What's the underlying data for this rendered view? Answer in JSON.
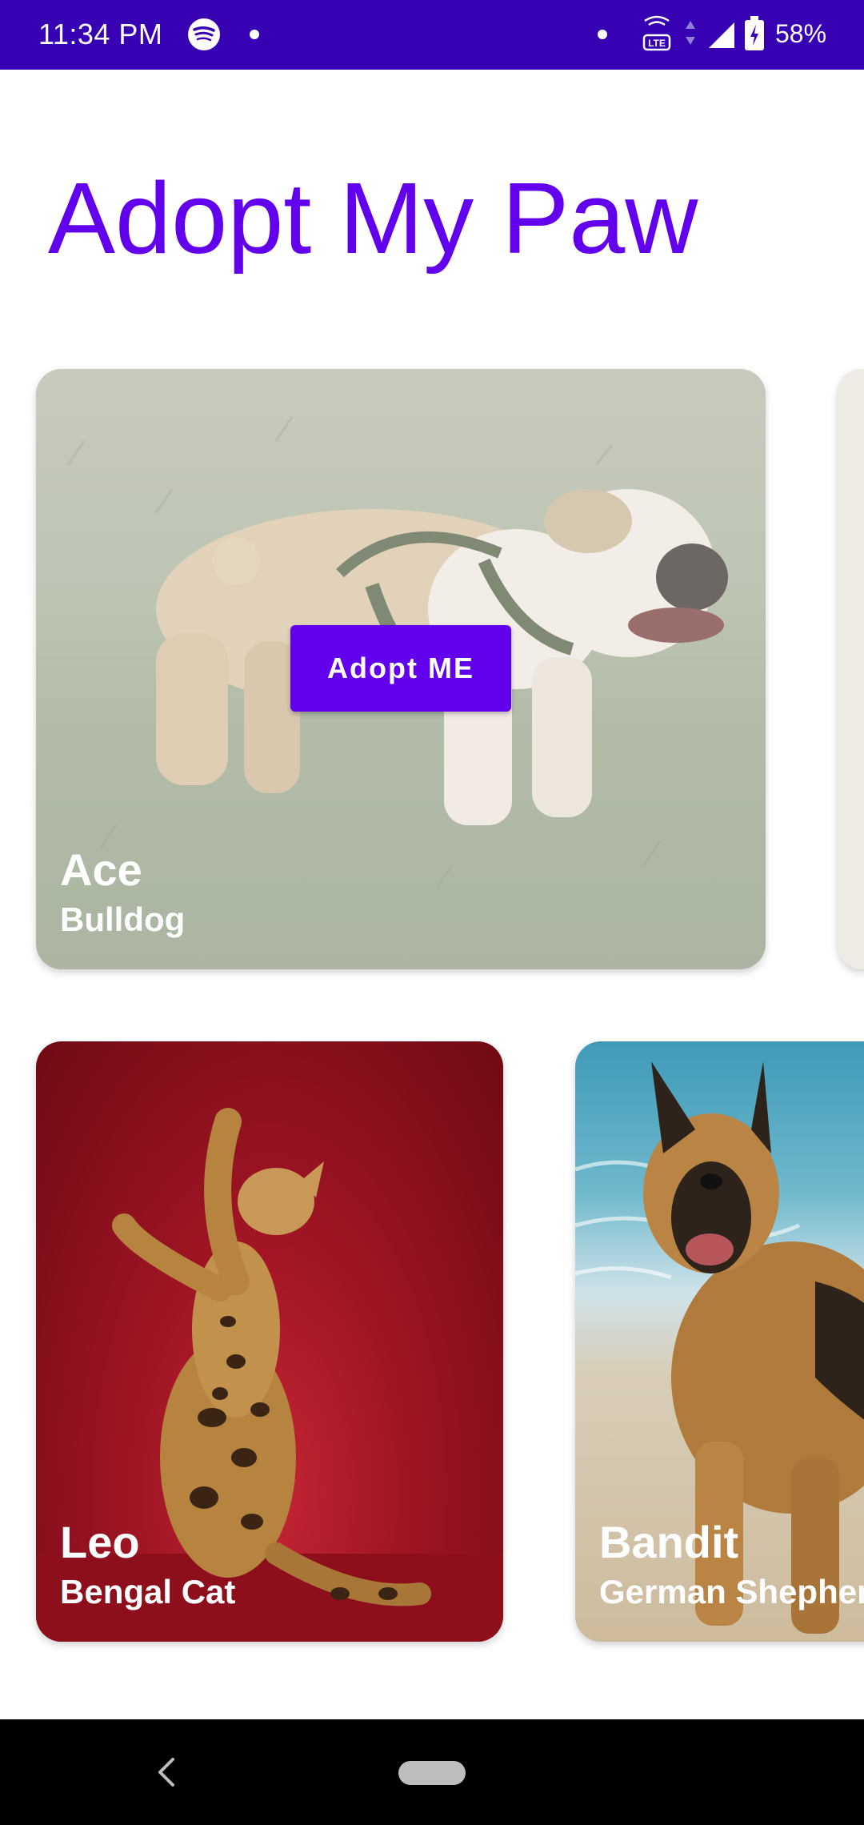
{
  "status_bar": {
    "time": "11:34 PM",
    "battery": "58%",
    "icons": [
      "spotify-icon",
      "notification-dot",
      "volte-icon",
      "data-arrows-icon",
      "signal-icon",
      "battery-icon"
    ]
  },
  "app": {
    "title": "Adopt My Paw"
  },
  "pets": [
    {
      "name": "Ace",
      "breed": "Bulldog",
      "action_label": "Adopt ME",
      "selected": true
    },
    {
      "name": "Leo",
      "breed": "Bengal Cat"
    },
    {
      "name": "Bandit",
      "breed": "German Shepherd"
    }
  ],
  "colors": {
    "status_bar": "#3700b3",
    "accent": "#6200ee",
    "nav_bar": "#000000"
  },
  "nav_bar": {
    "icons": [
      "back-icon",
      "home-pill"
    ]
  }
}
